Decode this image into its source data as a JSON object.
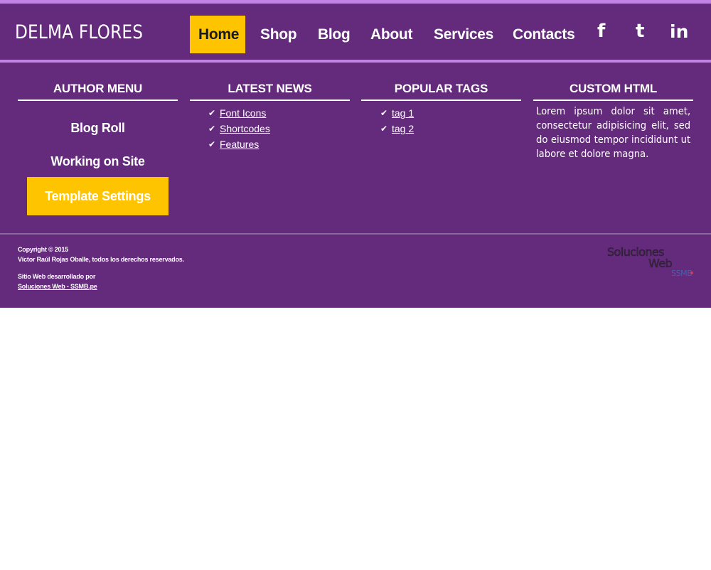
{
  "header": {
    "brand": "DELMA FLORES",
    "nav": [
      {
        "label": "Home",
        "active": true
      },
      {
        "label": "Shop"
      },
      {
        "label": "Blog"
      },
      {
        "label": "About"
      },
      {
        "label": "Services"
      },
      {
        "label": "Contacts"
      }
    ],
    "social": [
      {
        "label": "f",
        "icon": "facebook-icon"
      },
      {
        "label": "t",
        "icon": "twitter-icon"
      },
      {
        "label": "in",
        "icon": "linkedin-icon"
      }
    ]
  },
  "widgets": {
    "author_menu": {
      "title": "AUTHOR MENU",
      "links": [
        "Blog Roll",
        "Working on Site"
      ],
      "button": "Template Settings"
    },
    "latest_news": {
      "title": "LATEST NEWS",
      "items": [
        "Font Icons",
        "Shortcodes",
        "Features"
      ]
    },
    "popular_tags": {
      "title": "POPULAR TAGS",
      "items": [
        "tag 1",
        "tag 2"
      ]
    },
    "custom_html": {
      "title": "CUSTOM HTML",
      "text": "Lorem ipsum dolor sit amet, consectetur adipisicing elit, sed do eiusmod tempor incididunt ut labore et dolore magna."
    }
  },
  "footer": {
    "copyright": "Copyright © 2015",
    "owner": "Víctor Raúl Rojas Oballe, todos los derechos reservados.",
    "developed_by": "Sitio Web desarrollado por",
    "developer_link": "Soluciones Web - SSMB.pe",
    "logo": {
      "line1": "Soluciones",
      "line2": "Web",
      "line3": "SSMB"
    }
  },
  "colors": {
    "purple": "#642a7b",
    "lilac": "#c383e4",
    "accent": "#ffc400"
  }
}
